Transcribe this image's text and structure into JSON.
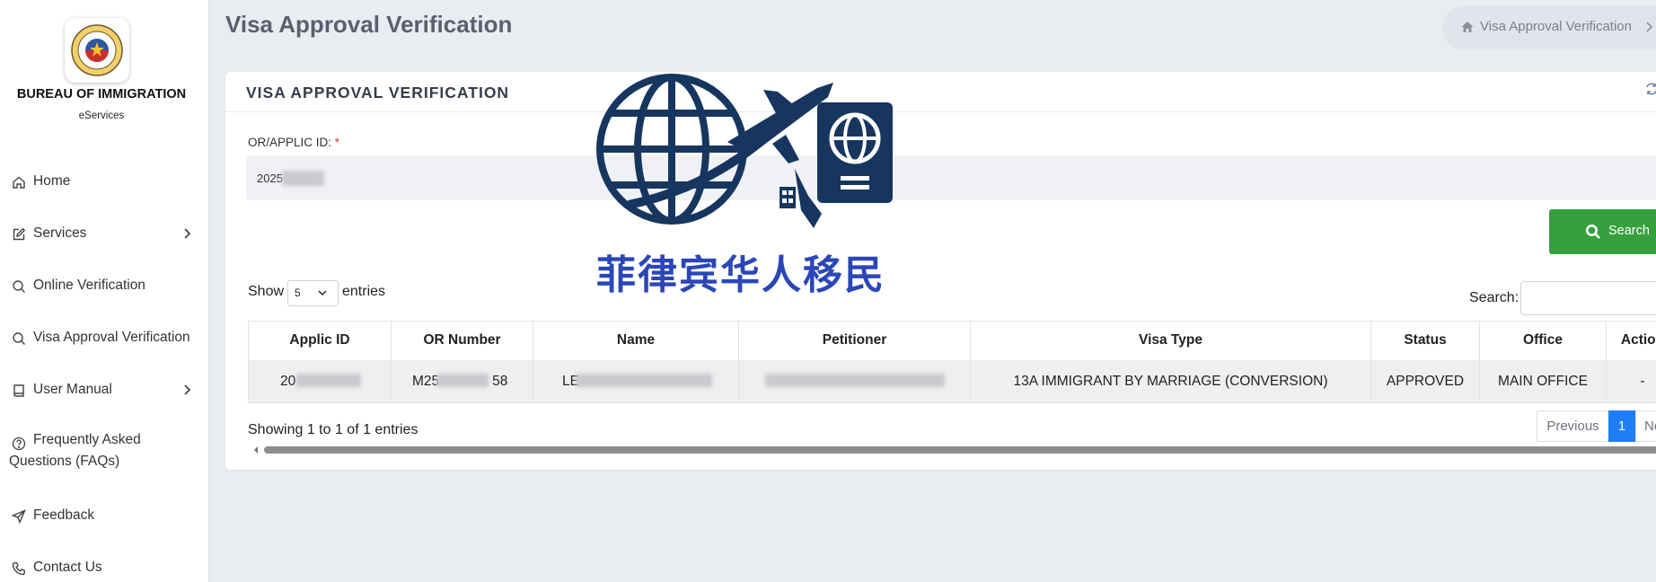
{
  "sidebar": {
    "org_name": "BUREAU OF IMMIGRATION",
    "org_sub": "eServices",
    "items": [
      {
        "label": "Home",
        "icon": "home-icon"
      },
      {
        "label": "Services",
        "icon": "edit-icon",
        "has_submenu": true
      },
      {
        "label": "Online Verification",
        "icon": "search-icon"
      },
      {
        "label": "Visa Approval Verification",
        "icon": "search-icon"
      },
      {
        "label": "User Manual",
        "icon": "book-icon",
        "has_submenu": true
      },
      {
        "label": "Frequently Asked",
        "label_line2": "Questions (FAQs)",
        "icon": "help-circle-icon"
      },
      {
        "label": "Feedback",
        "icon": "send-icon"
      },
      {
        "label": "Contact Us",
        "icon": "phone-icon"
      }
    ]
  },
  "header": {
    "page_title": "Visa Approval Verification",
    "breadcrumb": "Visa Approval Verification"
  },
  "card": {
    "title": "VISA APPROVAL VERIFICATION",
    "field_label": "OR/APPLIC ID:",
    "field_required_mark": "*",
    "field_value": "2025",
    "search_button": "Search",
    "length_prefix": "Show",
    "length_value": "5",
    "length_suffix": "entries",
    "search_label": "Search:",
    "table": {
      "columns": [
        "Applic ID",
        "OR Number",
        "Name",
        "Petitioner",
        "Visa Type",
        "Status",
        "Office",
        "Action"
      ],
      "rows": [
        {
          "applic_id": "20",
          "or_number_prefix": "M25",
          "or_number_suffix": "58",
          "name": "LE",
          "petitioner": "",
          "visa_type": "13A IMMIGRANT BY MARRIAGE (CONVERSION)",
          "status": "APPROVED",
          "office": "MAIN OFFICE",
          "action": "-"
        }
      ]
    },
    "showing_text": "Showing 1 to 1 of 1 entries",
    "pagination": {
      "previous": "Previous",
      "current": "1",
      "next": "Next"
    }
  },
  "watermark": {
    "text": "菲律宾华人移民"
  },
  "colors": {
    "search_button": "#36a03d",
    "pagination_active": "#1e7ef7",
    "watermark_navy": "#17365f",
    "watermark_text": "#2b46b7",
    "required_mark": "#e3342f"
  }
}
